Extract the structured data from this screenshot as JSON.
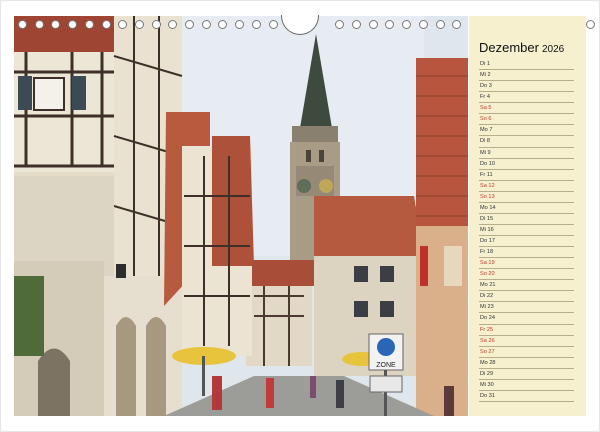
{
  "calendar": {
    "month": "Dezember",
    "year": "2026",
    "days": [
      {
        "label": "Di 1",
        "weekend": false
      },
      {
        "label": "Mi 2",
        "weekend": false
      },
      {
        "label": "Do 3",
        "weekend": false
      },
      {
        "label": "Fr 4",
        "weekend": false
      },
      {
        "label": "Sa 5",
        "weekend": true
      },
      {
        "label": "So 6",
        "weekend": true
      },
      {
        "label": "Mo 7",
        "weekend": false
      },
      {
        "label": "Di 8",
        "weekend": false
      },
      {
        "label": "Mi 9",
        "weekend": false
      },
      {
        "label": "Do 10",
        "weekend": false
      },
      {
        "label": "Fr 11",
        "weekend": false
      },
      {
        "label": "Sa 12",
        "weekend": true
      },
      {
        "label": "So 13",
        "weekend": true
      },
      {
        "label": "Mo 14",
        "weekend": false
      },
      {
        "label": "Di 15",
        "weekend": false
      },
      {
        "label": "Mi 16",
        "weekend": false
      },
      {
        "label": "Do 17",
        "weekend": false
      },
      {
        "label": "Fr 18",
        "weekend": false
      },
      {
        "label": "Sa 19",
        "weekend": true
      },
      {
        "label": "So 20",
        "weekend": true
      },
      {
        "label": "Mo 21",
        "weekend": false
      },
      {
        "label": "Di 22",
        "weekend": false
      },
      {
        "label": "Mi 23",
        "weekend": false
      },
      {
        "label": "Do 24",
        "weekend": false
      },
      {
        "label": "Fr 25",
        "weekend": true
      },
      {
        "label": "Sa 26",
        "weekend": true
      },
      {
        "label": "So 27",
        "weekend": true
      },
      {
        "label": "Mo 28",
        "weekend": false
      },
      {
        "label": "Di 29",
        "weekend": false
      },
      {
        "label": "Mi 30",
        "weekend": false
      },
      {
        "label": "Do 31",
        "weekend": false
      }
    ]
  },
  "photo": {
    "street_sign": "ZONE",
    "colors": {
      "sky": "#dfe6ec",
      "roof": "#b0503a",
      "timber": "#4a3a30",
      "plaster": "#e8e0cf"
    }
  },
  "colors": {
    "panel": "#f6f0cf",
    "weekend": "#c0392b",
    "rule": "#b6ae8a"
  }
}
